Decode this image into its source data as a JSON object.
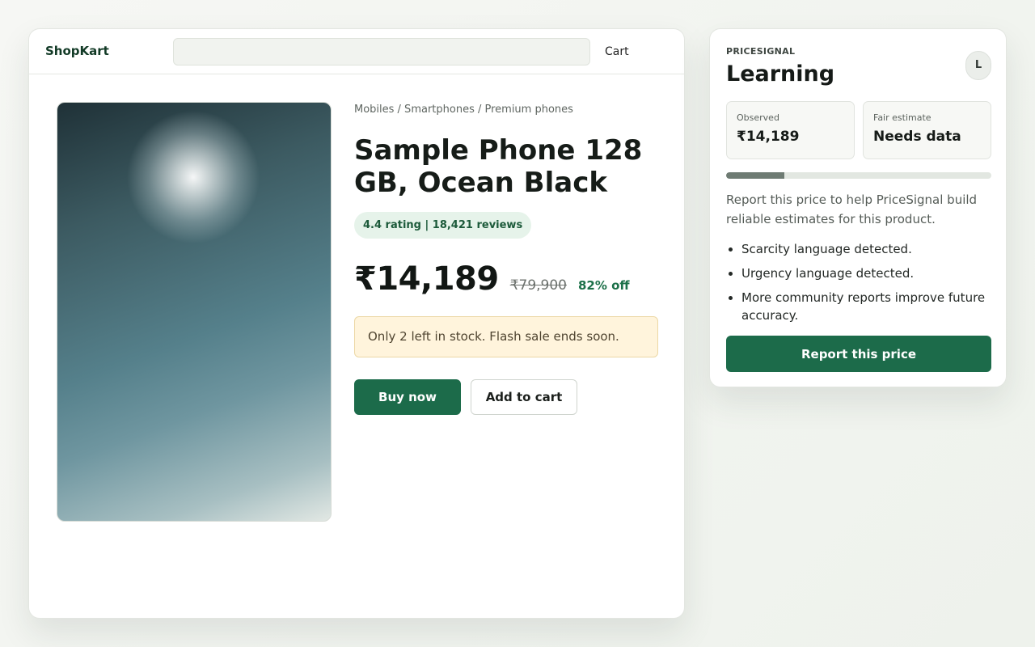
{
  "shop": {
    "brand": "ShopKart",
    "search": {
      "value": "",
      "placeholder": ""
    },
    "cart_label": "Cart"
  },
  "product": {
    "breadcrumb": "Mobiles / Smartphones / Premium phones",
    "title": "Sample Phone 128 GB, Ocean Black",
    "rating_text": "4.4 rating | 18,421 reviews",
    "price": "₹14,189",
    "mrp": "₹79,900",
    "discount": "82% off",
    "stock_alert": "Only 2 left in stock. Flash sale ends soon.",
    "buy_now_label": "Buy now",
    "add_to_cart_label": "Add to cart"
  },
  "price_signal": {
    "eyebrow": "PRICESIGNAL",
    "status": "Learning",
    "avatar_initial": "L",
    "observed_label": "Observed",
    "observed_value": "₹14,189",
    "fair_label": "Fair estimate",
    "fair_value": "Needs data",
    "confidence_progress": 0.22,
    "description": "Report this price to help PriceSignal build reliable estimates for this product.",
    "signals": [
      "Scarcity language detected.",
      "Urgency language detected.",
      "More community reports improve future accuracy."
    ],
    "report_button_label": "Report this price"
  },
  "colors": {
    "brand_green": "#1c6b4a",
    "alert_background": "#fff4dc",
    "rating_badge_background": "#e6f3ea",
    "progress_fill": "#6e7b73"
  }
}
